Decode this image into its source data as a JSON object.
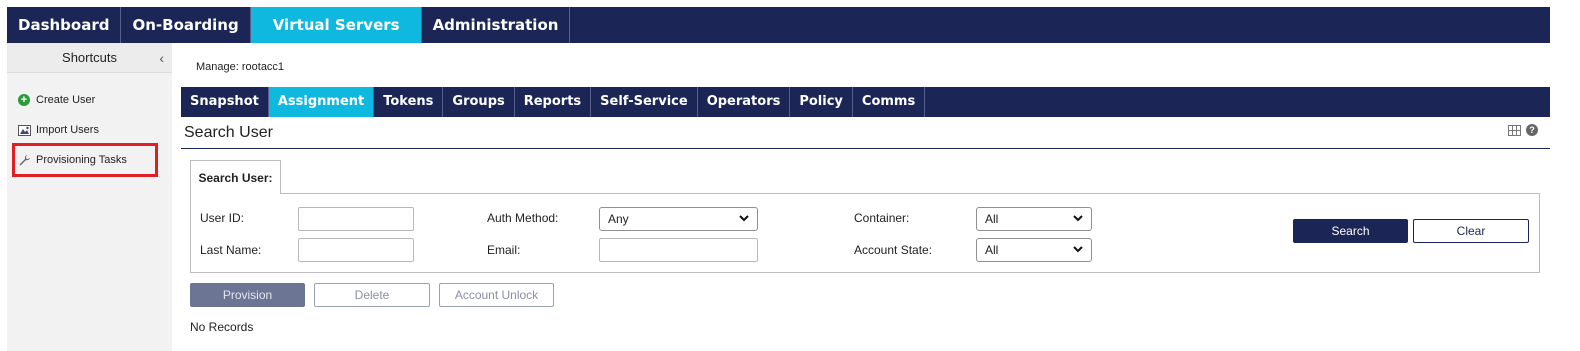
{
  "topnav": {
    "tabs": [
      {
        "label": "Dashboard",
        "active": false
      },
      {
        "label": "On-Boarding",
        "active": false
      },
      {
        "label": "Virtual Servers",
        "active": true
      },
      {
        "label": "Administration",
        "active": false
      }
    ]
  },
  "sidebar": {
    "title": "Shortcuts",
    "collapse_glyph": "‹",
    "items": [
      {
        "label": "Create User",
        "icon": "plus-circle-icon"
      },
      {
        "label": "Import Users",
        "icon": "import-users-icon"
      },
      {
        "label": "Provisioning Tasks",
        "icon": "wrench-icon"
      }
    ]
  },
  "manage": {
    "label": "Manage: rootacc1"
  },
  "subnav": {
    "tabs": [
      {
        "label": "Snapshot",
        "active": false
      },
      {
        "label": "Assignment",
        "active": true
      },
      {
        "label": "Tokens",
        "active": false
      },
      {
        "label": "Groups",
        "active": false
      },
      {
        "label": "Reports",
        "active": false
      },
      {
        "label": "Self-Service",
        "active": false
      },
      {
        "label": "Operators",
        "active": false
      },
      {
        "label": "Policy",
        "active": false
      },
      {
        "label": "Comms",
        "active": false
      }
    ]
  },
  "page": {
    "title": "Search User",
    "help_glyph": "?"
  },
  "search": {
    "tab_label": "Search User:",
    "user_id_label": "User ID:",
    "user_id_value": "",
    "last_name_label": "Last Name:",
    "last_name_value": "",
    "auth_method_label": "Auth Method:",
    "auth_method_value": "Any",
    "email_label": "Email:",
    "email_value": "",
    "container_label": "Container:",
    "container_value": "All",
    "account_state_label": "Account State:",
    "account_state_value": "All",
    "search_button": "Search",
    "clear_button": "Clear"
  },
  "actions": {
    "provision": "Provision",
    "delete": "Delete",
    "account_unlock": "Account Unlock"
  },
  "results": {
    "empty_text": "No Records"
  },
  "colors": {
    "navy": "#1b2657",
    "active_tab": "#0fb8df",
    "highlight_red": "#e31d24",
    "sidebar_bg": "#f2f2f2",
    "create_icon_green": "#2c9b3b"
  }
}
